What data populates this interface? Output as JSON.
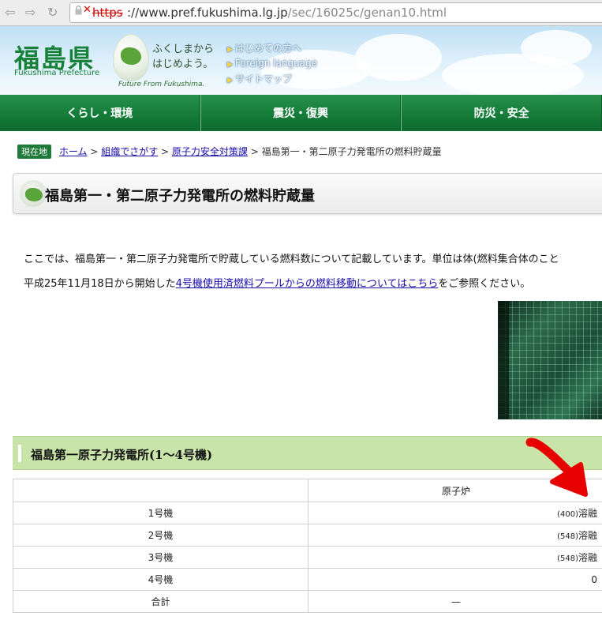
{
  "browser": {
    "url_scheme": "https",
    "url_host": "://www.pref.fukushima.lg.jp",
    "url_path": "/sec/16025c/genan10.html"
  },
  "header": {
    "logo_jp": "福島県",
    "logo_en": "Fukushima Prefecture",
    "tagline_1": "ふくしまから",
    "tagline_2": "はじめよう。",
    "future": "Future From Fukushima.",
    "links": [
      "はじめての方へ",
      "Foreign language",
      "サイトマップ"
    ]
  },
  "nav": {
    "items": [
      "くらし・環境",
      "震災・復興",
      "防災・安全"
    ]
  },
  "breadcrumb": {
    "here": "現在地",
    "home": "ホーム",
    "org": "組織でさがす",
    "dept": "原子力安全対策課",
    "current": "福島第一・第二原子力発電所の燃料貯蔵量",
    "sep": ">"
  },
  "page": {
    "title": "福島第一・第二原子力発電所の燃料貯蔵量",
    "intro": "ここでは、福島第一・第二原子力発電所で貯蔵している燃料数について記載しています。単位は体(燃料集合体のこと",
    "notice_prefix": "平成25年11月18日から開始した",
    "notice_link": "4号機使用済燃料プールからの燃料移動についてはこちら",
    "notice_suffix": "をご参照ください。"
  },
  "section": {
    "title": "福島第一原子力発電所(1〜4号機)"
  },
  "table": {
    "header": [
      "",
      "原子炉"
    ],
    "rows": [
      {
        "unit": "1号機",
        "reactor_note": "(400)",
        "reactor_status": "溶融"
      },
      {
        "unit": "2号機",
        "reactor_note": "(548)",
        "reactor_status": "溶融"
      },
      {
        "unit": "3号機",
        "reactor_note": "(548)",
        "reactor_status": "溶融"
      },
      {
        "unit": "4号機",
        "reactor_note": "",
        "reactor_status": "0"
      },
      {
        "unit": "合計",
        "reactor_note": "",
        "reactor_status": "—"
      }
    ]
  },
  "colors": {
    "brand_green": "#17813a",
    "nav_green": "#137a37",
    "section_bg": "#c8e4a8",
    "annotation_red": "#e60000"
  }
}
